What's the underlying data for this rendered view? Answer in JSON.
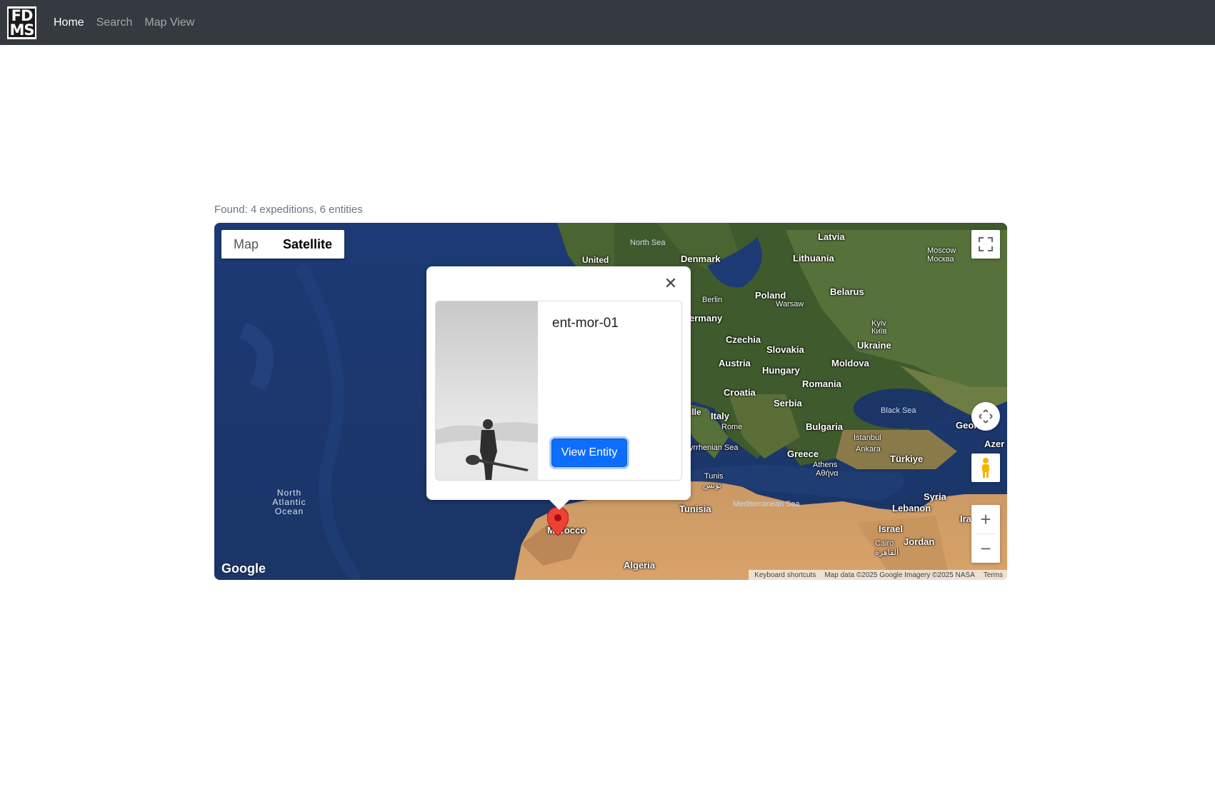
{
  "navbar": {
    "logo_top": "FD",
    "logo_bottom": "MS",
    "links": [
      {
        "label": "Home",
        "active": true
      },
      {
        "label": "Search",
        "active": false
      },
      {
        "label": "Map View",
        "active": false
      }
    ]
  },
  "found_text": "Found: 4 expeditions, 6 entities",
  "map": {
    "type_buttons": [
      "Map",
      "Satellite"
    ],
    "selected_type": "Satellite",
    "google_logo": "Google",
    "attribution": {
      "shortcuts": "Keyboard shortcuts",
      "data": "Map data ©2025 Google Imagery ©2025 NASA",
      "terms": "Terms"
    },
    "ocean_label": "North Atlantic Ocean",
    "labels": {
      "north_sea": "North Sea",
      "united": "United",
      "denmark": "Denmark",
      "latvia": "Latvia",
      "lithuania": "Lithuania",
      "moscow": "Moscow",
      "moscow_ru": "Москва",
      "berlin": "Berlin",
      "germany": "ermany",
      "poland": "Poland",
      "warsaw": "Warsaw",
      "belarus": "Belarus",
      "kyiv": "Kyiv",
      "kyiv_ua": "Київ",
      "ukraine": "Ukraine",
      "czechia": "Czechia",
      "slovakia": "Slovakia",
      "austria": "Austria",
      "hungary": "Hungary",
      "moldova": "Moldova",
      "romania": "Romania",
      "croatia": "Croatia",
      "serbia": "Serbia",
      "black_sea": "Black Sea",
      "italy": "Italy",
      "rome": "Rome",
      "bulgaria": "Bulgaria",
      "istanbul": "Istanbul",
      "ankara": "Ankara",
      "georgia": "Geor",
      "azer": "Azer",
      "tyrrhenian": "yrrhenian Sea",
      "greece": "Greece",
      "turkiye": "Türkiye",
      "athens": "Athens",
      "athens_gr": "Αθήνα",
      "tunis": "Tunis",
      "tunis_ar": "تونس",
      "syria": "Syria",
      "tunisia": "Tunisia",
      "med_sea": "Mediterranean Sea",
      "lebanon": "Lebanon",
      "iraq": "Ira",
      "morocco": "Morocco",
      "israel": "Israel",
      "jordan": "Jordan",
      "cairo": "Cairo",
      "cairo_ar": "القاهرة",
      "algeria": "Algeria",
      "ille": "ille"
    }
  },
  "infowindow": {
    "entity_name": "ent-mor-01",
    "button_label": "View Entity"
  }
}
